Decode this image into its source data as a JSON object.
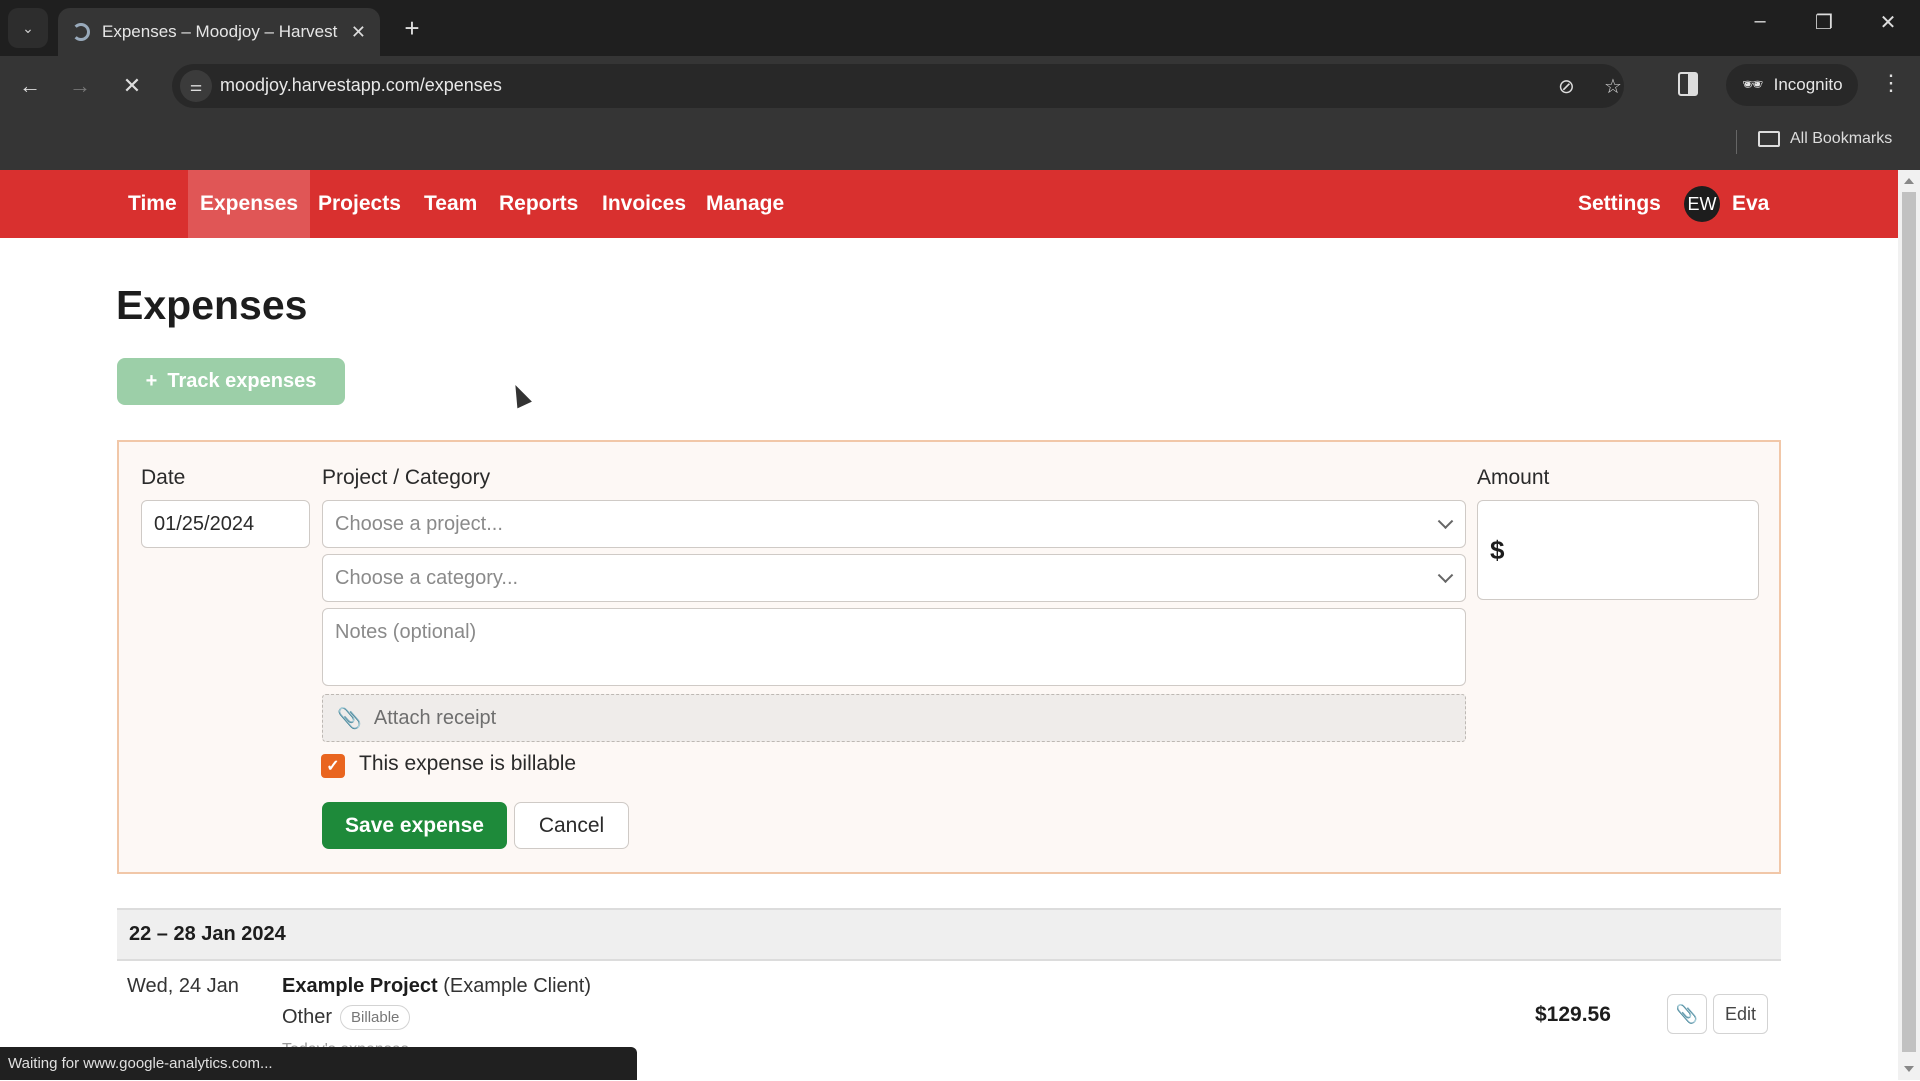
{
  "browser": {
    "tab_title": "Expenses – Moodjoy – Harvest",
    "url": "moodjoy.harvestapp.com/expenses",
    "incognito_label": "Incognito",
    "bookmarks_label": "All Bookmarks",
    "status_text": "Waiting for www.google-analytics.com..."
  },
  "nav": {
    "items": [
      {
        "label": "Time",
        "active": false
      },
      {
        "label": "Expenses",
        "active": true
      },
      {
        "label": "Projects",
        "active": false
      },
      {
        "label": "Team",
        "active": false
      },
      {
        "label": "Reports",
        "active": false
      },
      {
        "label": "Invoices",
        "active": false
      },
      {
        "label": "Manage",
        "active": false
      }
    ],
    "settings_label": "Settings",
    "user_initials": "EW",
    "user_name": "Eva",
    "brand_color": "#d9302f"
  },
  "page": {
    "title": "Expenses",
    "track_button": "Track expenses"
  },
  "form": {
    "date_label": "Date",
    "date_value": "01/25/2024",
    "project_category_label": "Project / Category",
    "project_placeholder": "Choose a project...",
    "category_placeholder": "Choose a category...",
    "notes_placeholder": "Notes (optional)",
    "attach_label": "Attach receipt",
    "amount_label": "Amount",
    "currency_symbol": "$",
    "billable_label": "This expense is billable",
    "billable_checked": true,
    "save_label": "Save expense",
    "cancel_label": "Cancel"
  },
  "list": {
    "week_label": "22 – 28 Jan 2024",
    "entries": [
      {
        "date": "Wed, 24 Jan",
        "project": "Example Project",
        "client": "(Example Client)",
        "category": "Other",
        "badge": "Billable",
        "note": "Today's expenses",
        "amount": "$129.56",
        "edit_label": "Edit"
      }
    ]
  }
}
